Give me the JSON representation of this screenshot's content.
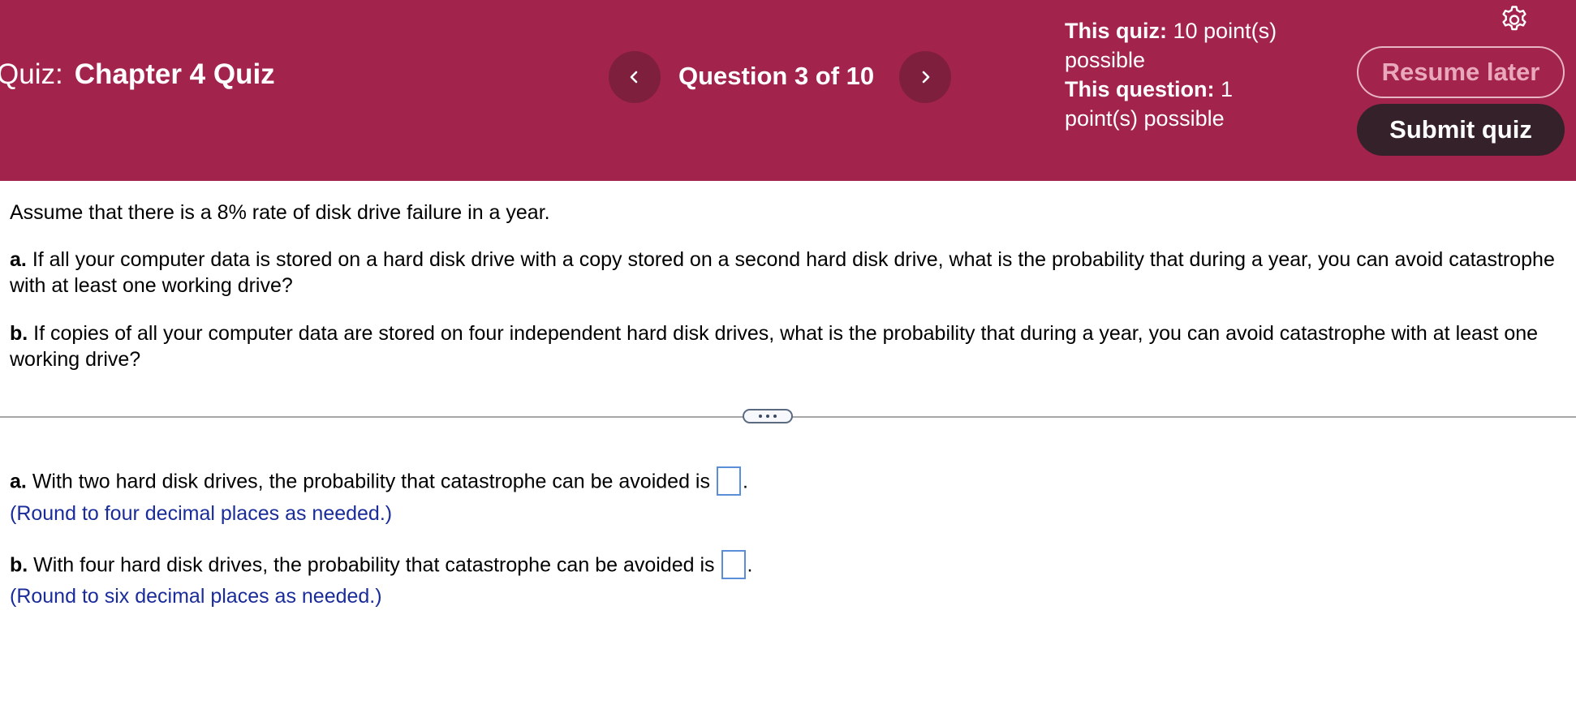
{
  "header": {
    "quiz_label": "Quiz:",
    "quiz_name": "Chapter 4 Quiz",
    "question_counter": "Question 3 of 10",
    "this_quiz_label": "This quiz:",
    "this_quiz_value": "10 point(s) possible",
    "this_question_label": "This question:",
    "this_question_value": "1 point(s) possible",
    "resume_label": "Resume later",
    "submit_label": "Submit quiz",
    "prev_icon": "chevron-left-icon",
    "next_icon": "chevron-right-icon",
    "settings_icon": "gear-icon"
  },
  "question": {
    "intro": "Assume that there is a 8% rate of disk drive failure in a year.",
    "part_a_label": "a.",
    "part_a_text": "If all your computer data is stored on a hard disk drive with a copy stored on a second hard disk drive, what is the probability that during a year, you can avoid catastrophe with at least one working drive?",
    "part_b_label": "b.",
    "part_b_text": "If copies of all your computer data are stored on four independent hard disk drives, what is the probability that during a year, you can avoid catastrophe with at least one working drive?"
  },
  "answers": {
    "a_label": "a.",
    "a_text": "With two hard disk drives, the probability that catastrophe can be avoided is",
    "a_value": "",
    "a_hint": "(Round to four decimal places as needed.)",
    "b_label": "b.",
    "b_text": "With four hard disk drives, the probability that catastrophe can be avoided is",
    "b_value": "",
    "b_hint": "(Round to six decimal places as needed.)",
    "period": "."
  },
  "colors": {
    "header_bg": "#a2234c",
    "nav_btn_bg": "#7e1f3e",
    "submit_bg": "#35212a",
    "hint_text": "#1a2c99",
    "input_border": "#5a8fd8"
  }
}
